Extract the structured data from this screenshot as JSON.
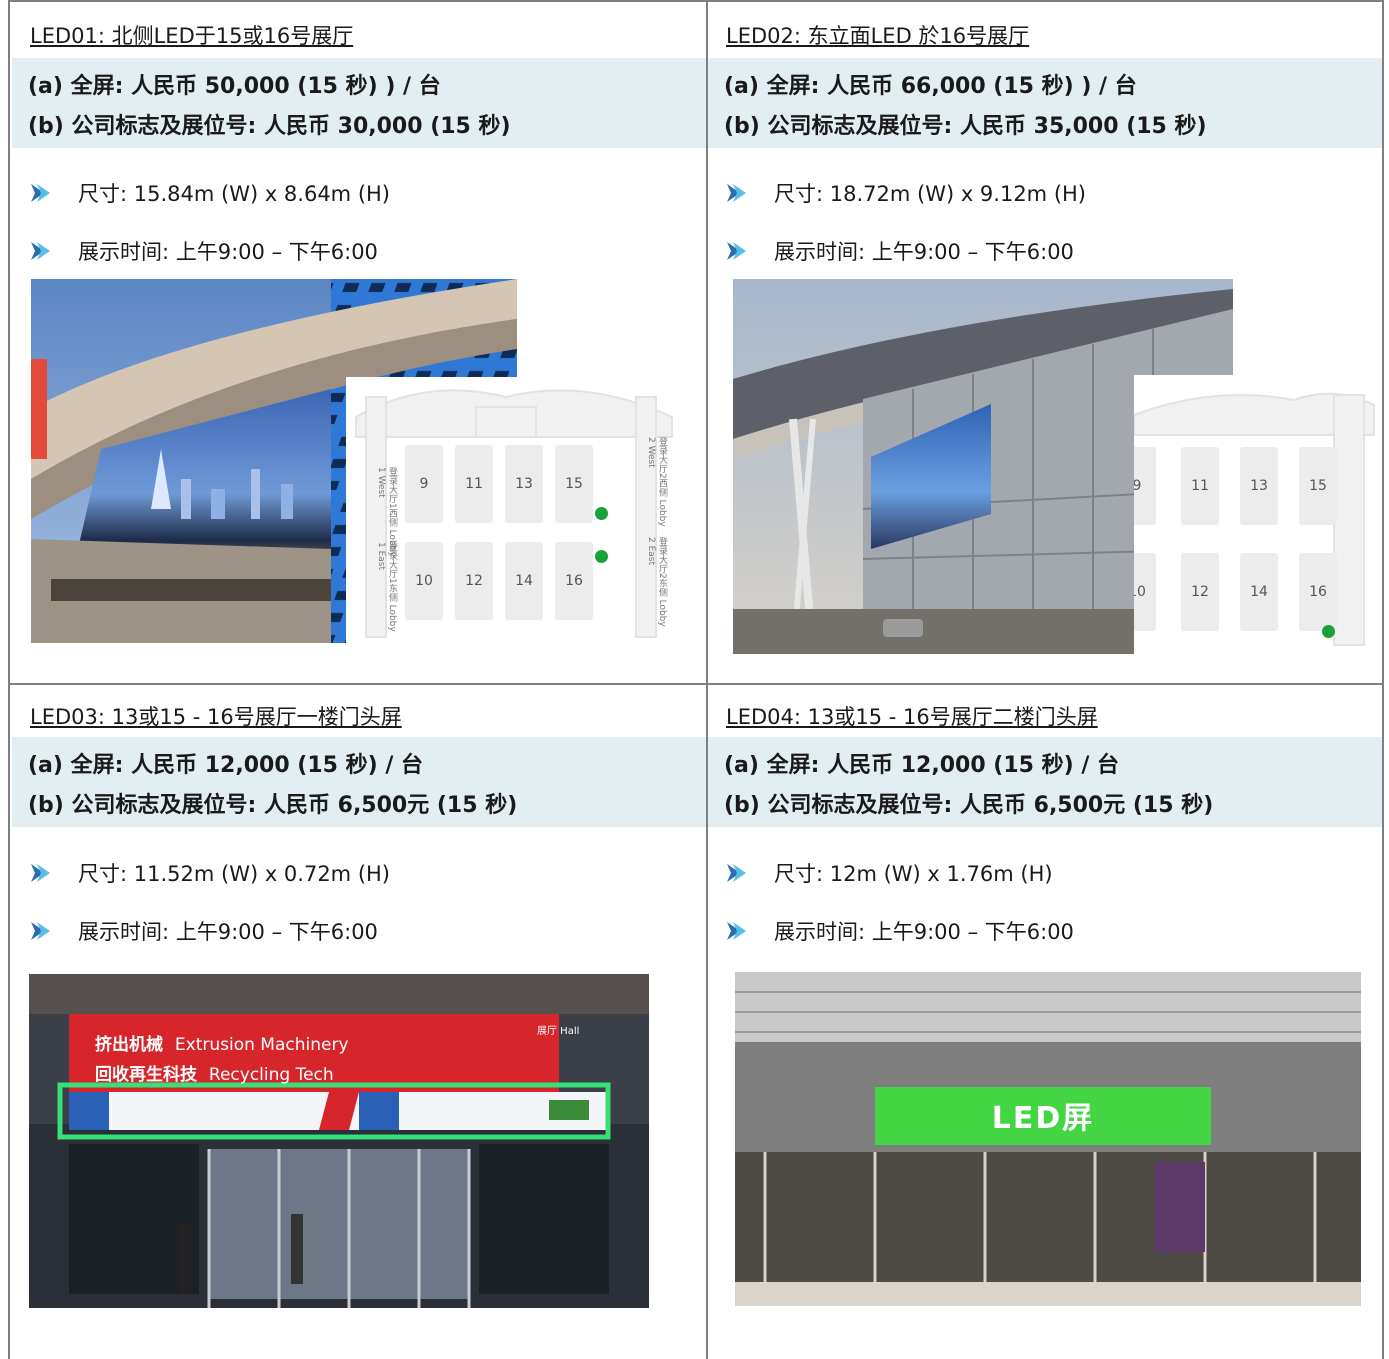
{
  "panels": [
    {
      "title": "LED01: 北侧LED于15或16号展厅",
      "price_a": "(a) 全屏: 人民币  50,000 (15 秒) ) / 台",
      "price_b": "(b) 公司标志及展位号: 人民币  30,000 (15 秒)",
      "size": "尺寸: 15.84m (W) x 8.64m (H)",
      "time": "展示时间: 上午9:00 –  下午6:00"
    },
    {
      "title": "LED02: 东立面LED 於16号展厅",
      "price_a": "(a) 全屏: 人民币  66,000 (15 秒) ) / 台",
      "price_b": "(b) 公司标志及展位号: 人民币  35,000 (15 秒)",
      "size": "尺寸: 18.72m (W) x 9.12m (H)",
      "time": "展示时间: 上午9:00 –  下午6:00"
    },
    {
      "title": "LED03: 13或15 - 16号展厅一楼门头屏",
      "price_a": "(a) 全屏: 人民币  12,000 (15 秒) / 台",
      "price_b": "(b) 公司标志及展位号: 人民币  6,500元  (15 秒)",
      "size": "尺寸: 11.52m (W) x 0.72m (H)",
      "time": "展示时间: 上午9:00 –  下午6:00"
    },
    {
      "title": "LED04: 13或15 - 16号展厅二楼门头屏",
      "price_a": "(a) 全屏: 人民币  12,000 (15 秒) / 台",
      "price_b": "(b) 公司标志及展位号: 人民币  6,500元  (15 秒)",
      "size": "尺寸: 12m (W) x 1.76m (H)",
      "time": "展示时间: 上午9:00 –  下午6:00"
    }
  ],
  "maps": {
    "halls_top": [
      "9",
      "11",
      "13",
      "15"
    ],
    "halls_bottom": [
      "10",
      "12",
      "14",
      "16"
    ],
    "lobby_1_west": "登录大厅1西侧 Lobby 1 West",
    "lobby_1_east": "登录大厅1东侧 Lobby 1 East",
    "lobby_2_west": "登录大厅2西侧 Lobby 2 West",
    "lobby_2_east": "登录大厅2东侧 Lobby 2 East"
  },
  "photo3": {
    "sign_cn_1": "挤出机械",
    "sign_en_1": "Extrusion Machinery",
    "sign_cn_2": "回收再生科技",
    "sign_en_2": "Recycling Tech",
    "hall_tag": "展厅 Hall"
  },
  "photo4": {
    "led_label": "LED屏"
  },
  "colors": {
    "band": "#e3eef2",
    "border": "#7f7f7f",
    "bullet": "#2b6cb0",
    "marker": "#1aa23a",
    "highlight": "#37e07a"
  }
}
